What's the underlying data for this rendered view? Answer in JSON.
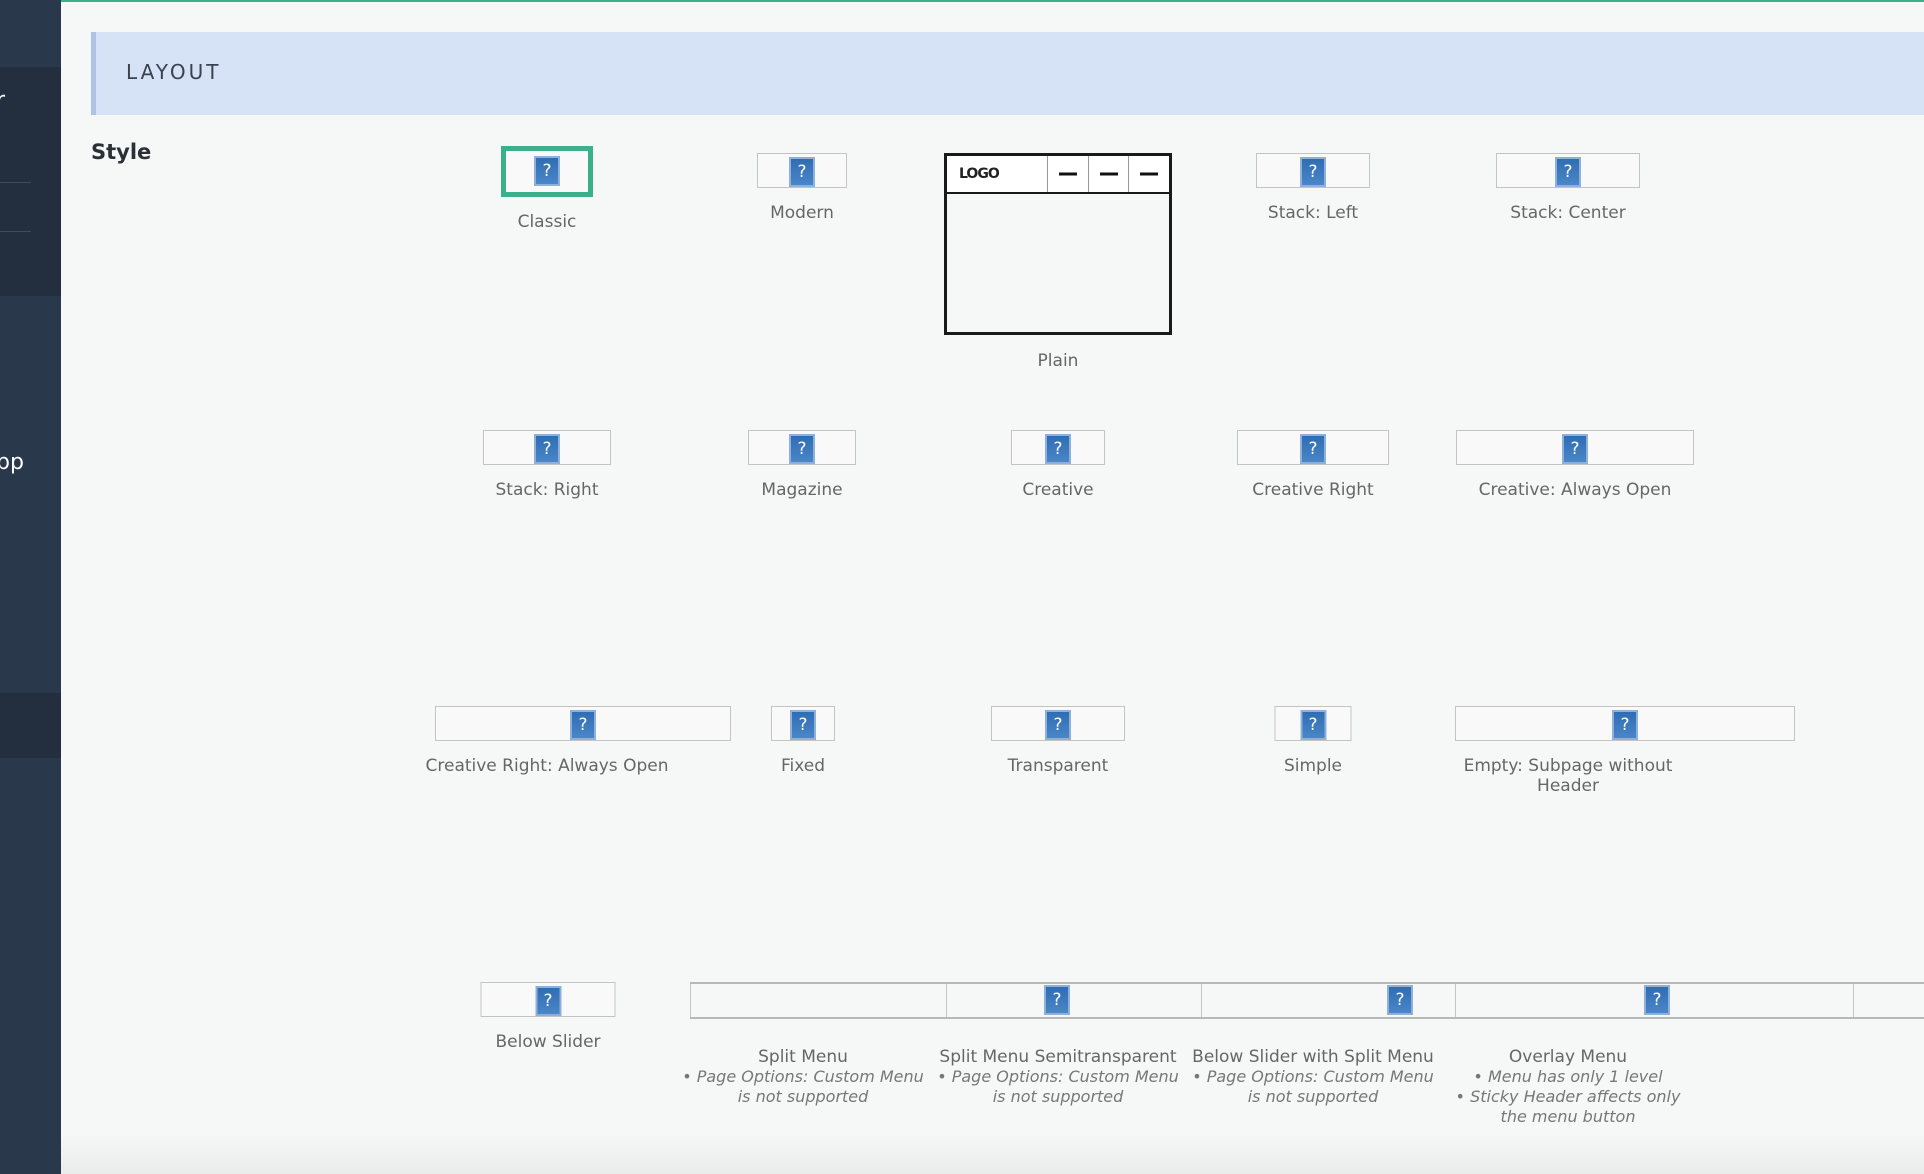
{
  "section_title": "LAYOUT",
  "field_label": "Style",
  "sidebar": {
    "partial_labels": [
      "r",
      "pp"
    ]
  },
  "accent_color": "#3cb08a",
  "selected": "Classic",
  "plain_preview": {
    "logo": "LOGO"
  },
  "styles": [
    {
      "label": "Classic",
      "icon": "question-mark-icon"
    },
    {
      "label": "Modern",
      "icon": "question-mark-icon"
    },
    {
      "label": "Plain"
    },
    {
      "label": "Stack: Left",
      "icon": "question-mark-icon"
    },
    {
      "label": "Stack: Center",
      "icon": "question-mark-icon"
    },
    {
      "label": "Stack: Right",
      "icon": "question-mark-icon"
    },
    {
      "label": "Magazine",
      "icon": "question-mark-icon"
    },
    {
      "label": "Creative",
      "icon": "question-mark-icon"
    },
    {
      "label": "Creative Right",
      "icon": "question-mark-icon"
    },
    {
      "label": "Creative: Always Open",
      "icon": "question-mark-icon"
    },
    {
      "label": "Creative Right: Always Open",
      "icon": "question-mark-icon"
    },
    {
      "label": "Fixed",
      "icon": "question-mark-icon"
    },
    {
      "label": "Transparent",
      "icon": "question-mark-icon"
    },
    {
      "label": "Simple",
      "icon": "question-mark-icon"
    },
    {
      "label": "Empty: Subpage without",
      "label2": "Header",
      "icon": "question-mark-icon"
    },
    {
      "label": "Below Slider",
      "icon": "question-mark-icon"
    },
    {
      "label": "Split Menu",
      "notes": [
        "• Page Options: Custom Menu",
        "is not supported"
      ]
    },
    {
      "label": "Split Menu Semitransparent",
      "notes": [
        "• Page Options: Custom Menu",
        "is not supported"
      ],
      "icon": "question-mark-icon"
    },
    {
      "label": "Below Slider with Split Menu",
      "notes": [
        "• Page Options: Custom Menu",
        "is not supported"
      ],
      "icon": "question-mark-icon"
    },
    {
      "label": "Overlay Menu",
      "notes": [
        "• Menu has only 1 level",
        "• Sticky Header affects only",
        "the menu button"
      ],
      "icon": "question-mark-icon"
    }
  ],
  "icon_glyph": "?"
}
